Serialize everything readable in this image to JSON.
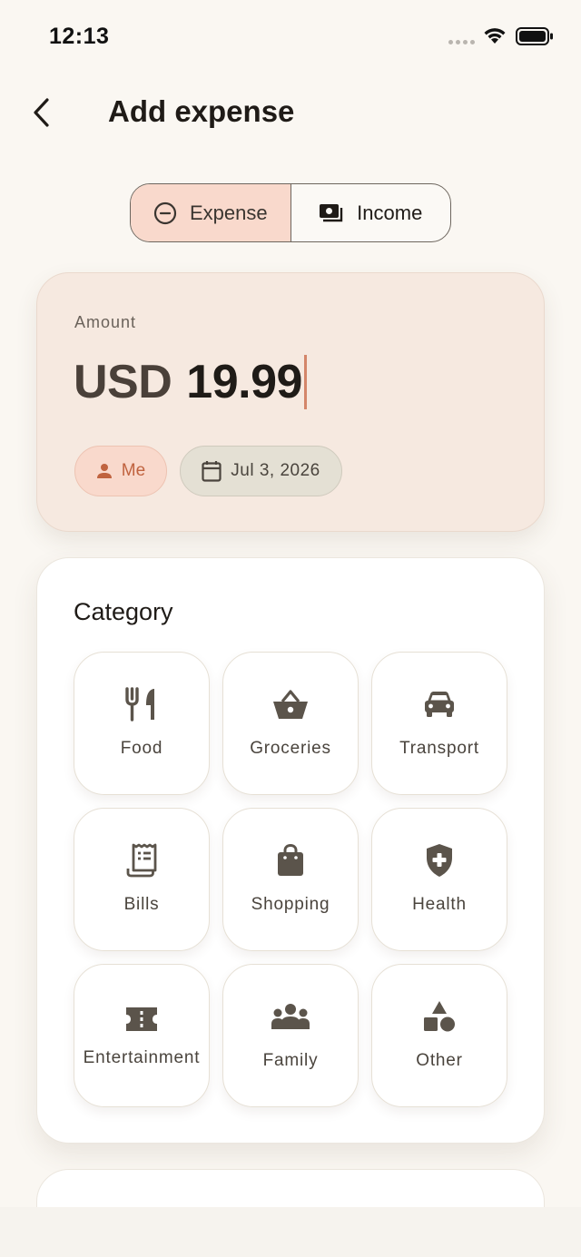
{
  "status_bar": {
    "time": "12:13"
  },
  "header": {
    "title": "Add expense"
  },
  "toggle": {
    "expense_label": "Expense",
    "income_label": "Income",
    "selected": "Expense"
  },
  "amount": {
    "label": "Amount",
    "currency": "USD",
    "value": "19.99"
  },
  "chips": {
    "person": "Me",
    "date": "Jul 3, 2026"
  },
  "category": {
    "title": "Category",
    "items": [
      {
        "label": "Food",
        "icon": "utensils-icon"
      },
      {
        "label": "Groceries",
        "icon": "basket-icon"
      },
      {
        "label": "Transport",
        "icon": "car-icon"
      },
      {
        "label": "Bills",
        "icon": "receipt-icon"
      },
      {
        "label": "Shopping",
        "icon": "shopping-bag-icon"
      },
      {
        "label": "Health",
        "icon": "shield-plus-icon"
      },
      {
        "label": "Entertainment",
        "icon": "ticket-icon"
      },
      {
        "label": "Family",
        "icon": "people-icon"
      },
      {
        "label": "Other",
        "icon": "shapes-icon"
      }
    ]
  },
  "colors": {
    "background": "#faf7f2",
    "accent": "#c0633f",
    "accent_soft": "#f9d9cc",
    "icon": "#5b544b"
  }
}
